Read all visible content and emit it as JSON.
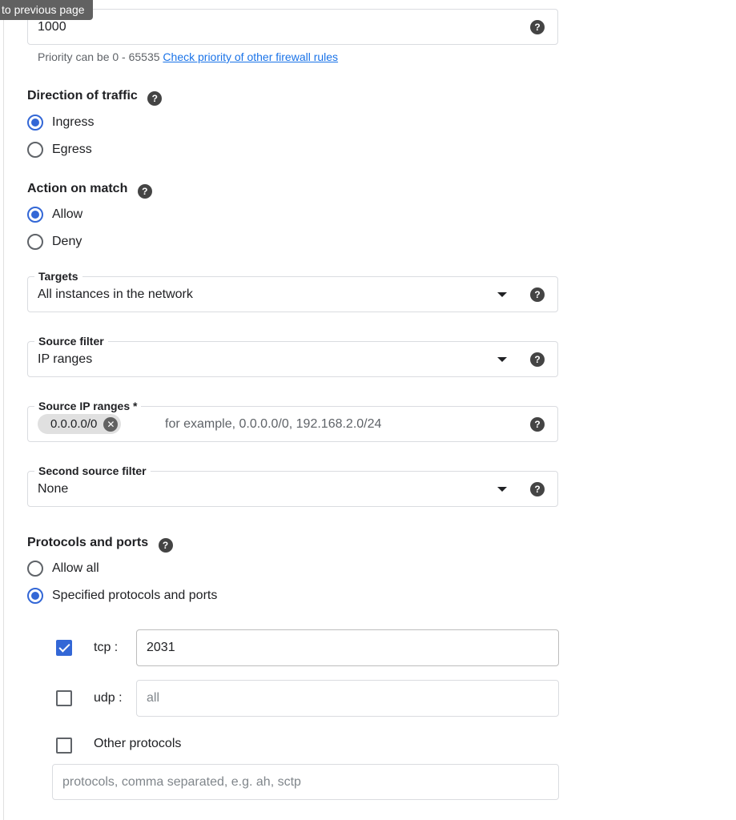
{
  "tooltip": "to previous page",
  "priority": {
    "value": "1000",
    "hint": "Priority can be 0 - 65535",
    "hint_link": "Check priority of other firewall rules"
  },
  "direction": {
    "title": "Direction of traffic",
    "options": [
      "Ingress",
      "Egress"
    ],
    "selected": "Ingress"
  },
  "action": {
    "title": "Action on match",
    "options": [
      "Allow",
      "Deny"
    ],
    "selected": "Allow"
  },
  "targets": {
    "label": "Targets",
    "value": "All instances in the network"
  },
  "source_filter": {
    "label": "Source filter",
    "value": "IP ranges"
  },
  "source_ip_ranges": {
    "label": "Source IP ranges *",
    "chip": "0.0.0.0/0",
    "placeholder": "for example, 0.0.0.0/0, 192.168.2.0/24"
  },
  "second_source_filter": {
    "label": "Second source filter",
    "value": "None"
  },
  "protocols": {
    "title": "Protocols and ports",
    "options": [
      "Allow all",
      "Specified protocols and ports"
    ],
    "selected": "Specified protocols and ports",
    "tcp": {
      "label": "tcp :",
      "checked": true,
      "value": "2031"
    },
    "udp": {
      "label": "udp :",
      "checked": false,
      "placeholder": "all"
    },
    "other": {
      "label": "Other protocols",
      "checked": false,
      "placeholder": "protocols, comma separated, e.g. ah, sctp"
    }
  },
  "icons": {
    "help": "?",
    "remove": "✕"
  }
}
